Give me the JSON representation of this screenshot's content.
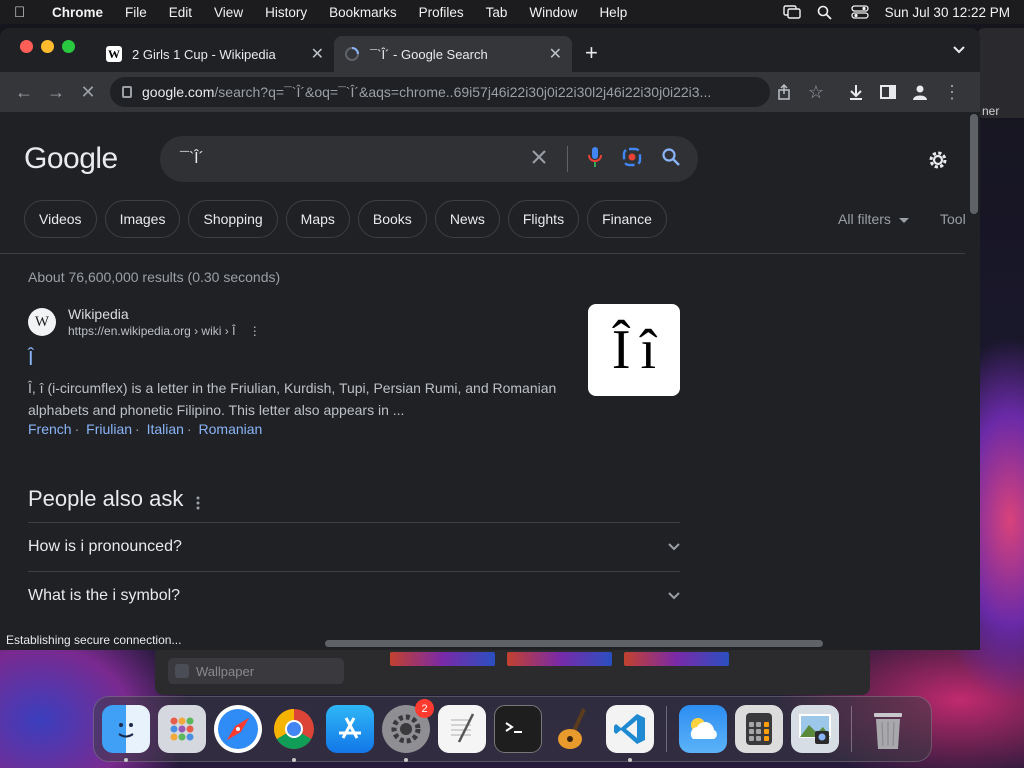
{
  "menubar": {
    "app_name": "Chrome",
    "items": [
      "File",
      "Edit",
      "View",
      "History",
      "Bookmarks",
      "Profiles",
      "Tab",
      "Window",
      "Help"
    ],
    "datetime": "Sun Jul 30  12:22 PM"
  },
  "tabs": [
    {
      "title": "2 Girls 1 Cup - Wikipedia",
      "favicon": "W"
    },
    {
      "title": "¯`Î´ - Google Search",
      "favicon": "G"
    }
  ],
  "address": {
    "host": "google.com",
    "path": "/search?q=¯`Î´&oq=¯`Î´&aqs=chrome..69i57j46i22i30j0i22i30l2j46i22i30j0i22i3..."
  },
  "search": {
    "logo": "Google",
    "query": "¯`Î´"
  },
  "chips": [
    "Videos",
    "Images",
    "Shopping",
    "Maps",
    "Books",
    "News",
    "Flights",
    "Finance"
  ],
  "filters": {
    "all_filters": "All filters",
    "tools": "Tool"
  },
  "stats": "About 76,600,000 results (0.30 seconds)",
  "result": {
    "favicon": "W",
    "site": "Wikipedia",
    "url": "https://en.wikipedia.org › wiki › Î",
    "title": "Î",
    "snippet": "Î, î (i-circumflex) is a letter in the Friulian, Kurdish, Tupi, Persian Rumi, and Romanian alphabets and phonetic Filipino. This letter also appears in ...",
    "sitelinks": [
      "French",
      "Friulian",
      "Italian",
      "Romanian"
    ],
    "thumb_upper": "Î",
    "thumb_lower": "î"
  },
  "people_also_ask": {
    "title": "People also ask",
    "questions": [
      "How is i pronounced?",
      "What is the i symbol?"
    ]
  },
  "status_text": "Establishing secure connection...",
  "background": {
    "wallpaper_item": "Wallpaper",
    "side_text": "ner"
  },
  "dock": {
    "badge_count": "2",
    "apps": [
      "finder-icon",
      "launchpad-icon",
      "safari-icon",
      "chrome-icon",
      "app-store-icon",
      "system-settings-icon",
      "textedit-icon",
      "terminal-icon",
      "garageband-icon",
      "vscode-icon",
      "weather-icon",
      "calculator-icon",
      "preview-icon",
      "trash-icon"
    ]
  },
  "colors": {
    "link": "#8ab4f8",
    "page_bg": "#202124",
    "chrome_toolbar": "#35363a"
  }
}
